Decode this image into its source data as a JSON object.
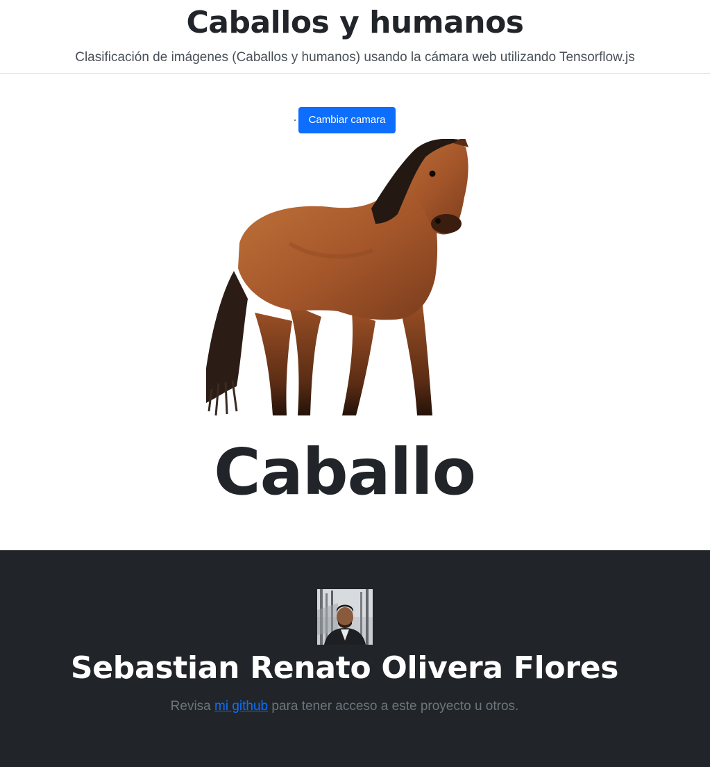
{
  "header": {
    "title": "Caballos y humanos",
    "subtitle": "Clasificación de imágenes (Caballos y humanos) usando la cámara web utilizando Tensorflow.js"
  },
  "controls": {
    "switch_camera_label": "Cambiar camara"
  },
  "prediction": {
    "label": "Caballo"
  },
  "footer": {
    "author_name": "Sebastian Renato Olivera Flores",
    "note_before": "Revisa ",
    "github_link_label": "mi github",
    "note_after": " para tener acceso a este proyecto u otros."
  },
  "colors": {
    "primary": "#0d6efd",
    "footer_bg": "#212529",
    "text_dark": "#212529",
    "text_muted": "#6c757d"
  }
}
